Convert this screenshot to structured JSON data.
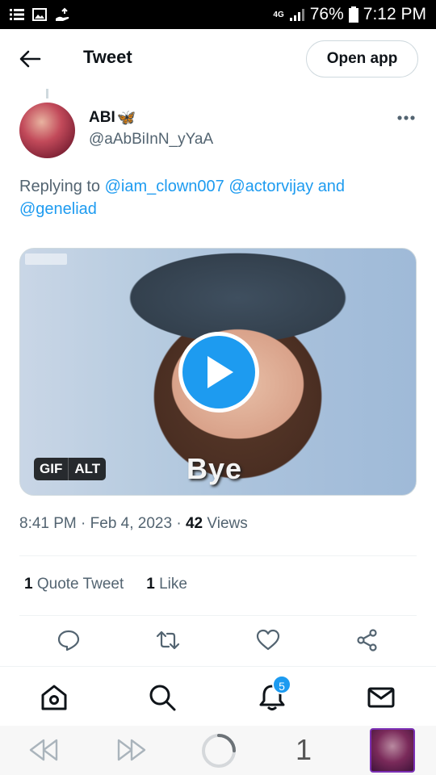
{
  "status_bar": {
    "network": "4G",
    "battery": "76%",
    "time": "7:12 PM"
  },
  "header": {
    "title": "Tweet",
    "open_app_label": "Open app"
  },
  "tweet": {
    "author_name": "ABI",
    "author_emoji": "🦋",
    "author_handle": "@aAbBiInN_yYaA",
    "replying_prefix": "Replying to",
    "mentions": [
      "@iam_clown007",
      "@actorvijay"
    ],
    "and_text": "and",
    "last_mention": "@geneliad",
    "media": {
      "overlay_text": "Bye",
      "gif_badge": "GIF",
      "alt_badge": "ALT"
    },
    "time": "8:41 PM",
    "date": "Feb 4, 2023",
    "views_count": "42",
    "views_label": "Views",
    "quote_count": "1",
    "quote_label": "Quote Tweet",
    "like_count": "1",
    "like_label": "Like"
  },
  "bottom_nav": {
    "notification_count": "5"
  },
  "browser": {
    "tab_count": "1"
  },
  "colors": {
    "accent": "#1d9bf0",
    "text": "#0f1419",
    "secondary": "#536471"
  },
  "icons": [
    "back-arrow-icon",
    "more-icon",
    "play-icon",
    "reply-icon",
    "retweet-icon",
    "like-icon",
    "share-icon",
    "home-icon",
    "search-icon",
    "bell-icon",
    "mail-icon",
    "rewind-icon",
    "forward-icon",
    "loading-icon"
  ]
}
